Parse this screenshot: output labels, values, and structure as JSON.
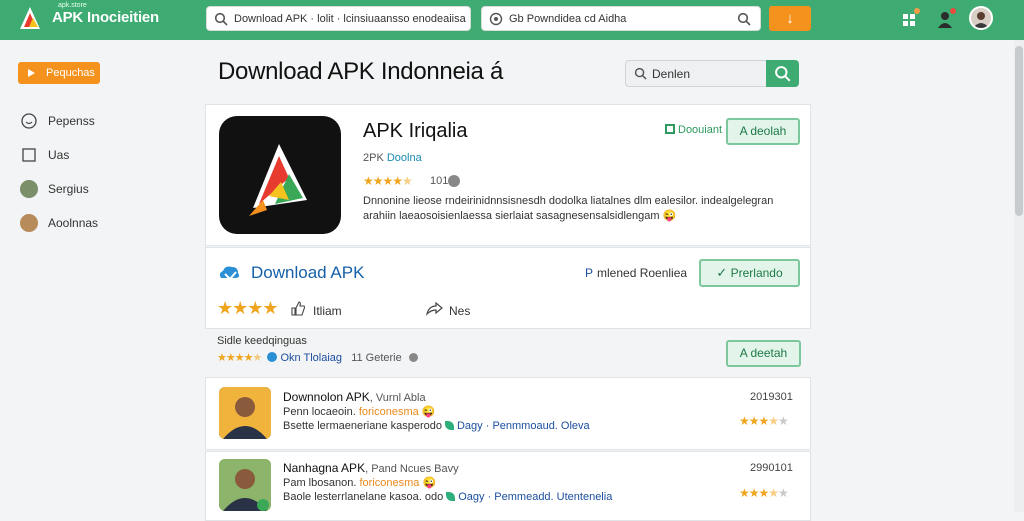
{
  "topbar": {
    "brand_small": "apk.store",
    "brand": "APK Inocieitien",
    "search1_value": "Download APK · lolit · lcinsiuaansso enodeaiisaa",
    "search2_value": "Gb Powndidea cd Aidha",
    "action_label": "↓"
  },
  "sidebar": {
    "button_label": "Pequchas",
    "items": [
      {
        "label": "Pepenss",
        "icon": "smile-icon"
      },
      {
        "label": "Uas",
        "icon": "square-icon"
      },
      {
        "label": "Sergius",
        "icon": "avatar-icon"
      },
      {
        "label": "Aoolnnas",
        "icon": "avatar-icon"
      }
    ]
  },
  "page": {
    "title": "Download APK Indonneia á",
    "search_value": "Denlen"
  },
  "app": {
    "name": "APK Iriqalia",
    "sub_prefix": "2PK",
    "sub_highlight": "Doolna",
    "rating_text": "101",
    "rating_stars": 4.5,
    "description": "Dnnonine lieose rndeirinidnnsisnesdh dodolka liatalnes dlm ealesilor. indealgelegran arahiin laeaosoisienlaessa sierlaiat sasagnesensalsidlengam 😜",
    "link_label": "Doouiant",
    "detail_button": "A deolah"
  },
  "download": {
    "title": "Download APK",
    "meta_prefix": "P",
    "meta_text": "mlened Roenliea",
    "button": "Prerlando",
    "stars": 4,
    "mid_label": "Itliam",
    "share_label": "Nes"
  },
  "summary": {
    "label": "Sidle keedqinguas",
    "stars": 4.5,
    "tag": "Okn Tlolaiag",
    "count": "11 Geterie",
    "button": "A deetah"
  },
  "reviews": [
    {
      "name": "Downnolon APK",
      "name_extra": ", Vurnl Abla",
      "line2_prefix": "Penn locaeoin.",
      "line2_highlight": "foriconesma",
      "line3_prefix": "Bsette lermaeneriane kasperodo",
      "line3_blue": "Dagy · Penmmoaud. Oleva",
      "date": "2019301",
      "stars": 3.5
    },
    {
      "name": "Nanhagna APK",
      "name_extra": ", Pand Ncues Bavy",
      "line2_prefix": "Pam lbosanon.",
      "line2_highlight": "foriconesma",
      "line3_prefix": "Baole lesterrlanelane kasoa. odo",
      "line3_blue": "Oagy · Pemmeadd. Utentenelia",
      "date": "2990101",
      "stars": 3.5
    }
  ],
  "colors": {
    "primary_green": "#3dab72",
    "accent_orange": "#f5921e",
    "link_blue": "#1560a8",
    "star_gold": "#f0a51e"
  }
}
